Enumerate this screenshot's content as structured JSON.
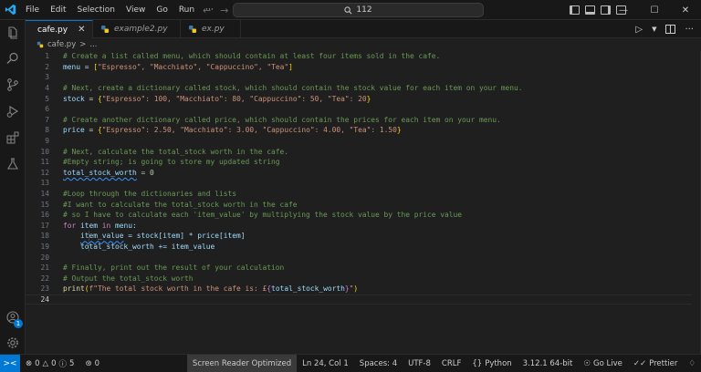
{
  "menu": [
    "File",
    "Edit",
    "Selection",
    "View",
    "Go",
    "Run",
    "···"
  ],
  "search": {
    "text": "112"
  },
  "window": {
    "minimize": "—",
    "maximize": "☐",
    "close": "✕"
  },
  "tabs": [
    {
      "label": "cafe.py"
    },
    {
      "label": "example2.py"
    },
    {
      "label": "ex.py"
    }
  ],
  "tab_close": "✕",
  "breadcrumb": {
    "file": "cafe.py",
    "sep": ">",
    "more": "..."
  },
  "editor_actions": {
    "run": "▷",
    "more": "···"
  },
  "code": {
    "line_numbers": [
      "1",
      "2",
      "3",
      "4",
      "5",
      "6",
      "7",
      "8",
      "9",
      "10",
      "11",
      "12",
      "13",
      "14",
      "15",
      "16",
      "17",
      "18",
      "19",
      "20",
      "21",
      "22",
      "23",
      "24"
    ],
    "l1": "# Create a list called menu, which should contain at least four items sold in the cafe.",
    "l2": {
      "var": "menu",
      "op": " = ",
      "open": "[",
      "items": "\"Espresso\", \"Macchiato\", \"Cappuccino\", \"Tea\"",
      "close": "]"
    },
    "l4": "# Next, create a dictionary called stock, which should contain the stock value for each item on your menu.",
    "l5": {
      "var": "stock",
      "op": " = ",
      "open": "{",
      "body": "\"Espresso\": 100, \"Macchiato\": 80, \"Cappuccino\": 50, \"Tea\": 20",
      "close": "}"
    },
    "l7": "# Create another dictionary called price, which should contain the prices for each item on your menu.",
    "l8": {
      "var": "price",
      "op": " = ",
      "open": "{",
      "body": "\"Espresso\": 2.50, \"Macchiato\": 3.00, \"Cappuccino\": 4.00, \"Tea\": 1.50",
      "close": "}"
    },
    "l10": "# Next, calculate the total_stock worth in the cafe.",
    "l11": "#Empty string; is going to store my updated string",
    "l12": {
      "var": "total_stock_worth",
      "rest": " = 0"
    },
    "l14": "#Loop through the dictionaries and lists",
    "l15": "#I want to calculate the total_stock worth in the cafe",
    "l16": "# so I have to calculate each 'item_value' by multiplying the stock value by the price value",
    "l17": {
      "kw1": "for",
      "v1": " item ",
      "kw2": "in",
      "v2": " menu:"
    },
    "l18": {
      "var": "item_value",
      "rest": " = stock[item] * price[item]"
    },
    "l19": "total_stock_worth += item_value",
    "l21": "# Finally, print out the result of your calculation",
    "l22": "# Output the total_stock worth",
    "l23": {
      "fn": "print",
      "open": "(",
      "fstr": "f\"The total stock worth in the cafe is: £",
      "ib1": "{",
      "ivar": "total_stock_worth",
      "ib2": "}",
      "fend": "\"",
      "close": ")"
    }
  },
  "status": {
    "remote": "><",
    "errors": "0",
    "warnings": "0",
    "info": "5",
    "ports": "0",
    "screen_reader": "Screen Reader Optimized",
    "position": "Ln 24, Col 1",
    "spaces": "Spaces: 4",
    "encoding": "UTF-8",
    "eol": "CRLF",
    "language": "Python",
    "interpreter": "3.12.1 64-bit",
    "golive": "Go Live",
    "prettier": "Prettier"
  },
  "activity_badge": "1",
  "colors": {
    "accent": "#0078d4",
    "comment": "#6a9955",
    "string": "#ce9178",
    "variable": "#9cdcfe",
    "number": "#b5cea8",
    "keyword": "#c586c0",
    "function": "#dcdcaa"
  }
}
